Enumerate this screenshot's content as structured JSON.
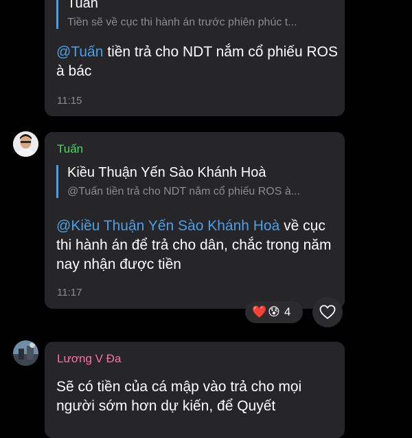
{
  "messages": [
    {
      "quote_author": "Tuấn",
      "quote_text": "Tiền sẽ về cục thi hành án trước phiên phúc t...",
      "mention": "@Tuấn",
      "text": " tiền trả cho NDT nắm cổ phiếu ROS à bác",
      "time": "11:15"
    },
    {
      "sender": "Tuấn",
      "sender_color": "#4cd964",
      "quote_author": "Kiều Thuận Yến Sào Khánh Hoà",
      "quote_text": "@Tuấn tiền trả cho NDT nắm cổ phiếu ROS à...",
      "mention": "@Kiều Thuận Yến Sào Khánh Hoà",
      "text": " về cục thi hành án để trả cho dân, chắc trong năm nay nhận được tiền",
      "time": "11:17",
      "reactions": {
        "emojis": [
          "❤️",
          "😰"
        ],
        "count": "4"
      }
    },
    {
      "sender": "Lương V Đa",
      "sender_color": "#ff6fa5",
      "text": "Sẽ có tiền của cá mập vào trả cho mọi người sớm hơn dự kiến, để Quyết"
    }
  ],
  "colors": {
    "background": "#000000",
    "bubble": "#262628",
    "link": "#4d9fe8",
    "muted": "#8c8c92"
  },
  "icons": {
    "heart_button": "heart-outline-icon"
  }
}
